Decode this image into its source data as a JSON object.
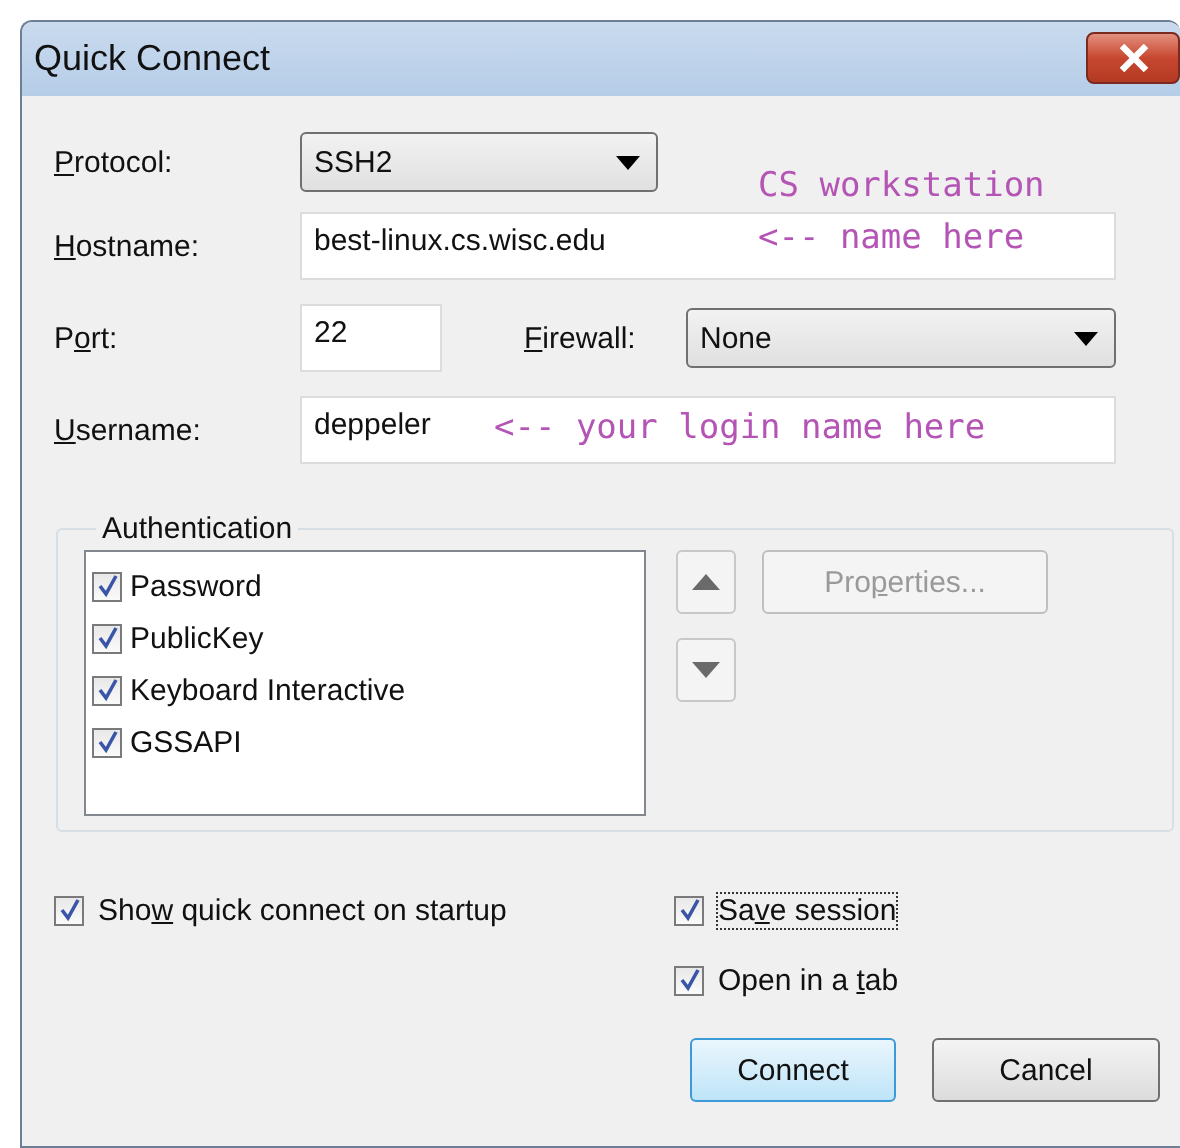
{
  "window": {
    "title": "Quick Connect"
  },
  "protocol": {
    "label": [
      {
        "t": "P",
        "u": true
      },
      {
        "t": "rotocol:",
        "u": false
      }
    ],
    "value": "SSH2"
  },
  "hostname": {
    "label": [
      {
        "t": "H",
        "u": true
      },
      {
        "t": "ostname:",
        "u": false
      }
    ],
    "value": "best-linux.cs.wisc.edu",
    "note_above": "CS workstation",
    "note": "<-- name here"
  },
  "port": {
    "label": [
      {
        "t": "P",
        "u": false
      },
      {
        "t": "o",
        "u": true
      },
      {
        "t": "rt:",
        "u": false
      }
    ],
    "value": "22"
  },
  "firewall": {
    "label": [
      {
        "t": "F",
        "u": true
      },
      {
        "t": "irewall:",
        "u": false
      }
    ],
    "value": "None"
  },
  "username": {
    "label": [
      {
        "t": "U",
        "u": true
      },
      {
        "t": "sername:",
        "u": false
      }
    ],
    "value": "deppeler",
    "note": "<-- your login name here"
  },
  "authentication": {
    "title": "Authentication",
    "methods": [
      {
        "label": "Password",
        "checked": true
      },
      {
        "label": "PublicKey",
        "checked": true
      },
      {
        "label": "Keyboard Interactive",
        "checked": true
      },
      {
        "label": "GSSAPI",
        "checked": true
      }
    ],
    "properties_button": {
      "label": [
        {
          "t": "Pro",
          "u": false
        },
        {
          "t": "p",
          "u": true
        },
        {
          "t": "erties...",
          "u": false
        }
      ],
      "disabled": true
    }
  },
  "options": [
    {
      "label": [
        {
          "t": "Sho",
          "u": false
        },
        {
          "t": "w",
          "u": true
        },
        {
          "t": " quick connect on startup",
          "u": false
        }
      ],
      "checked": true,
      "focused": false
    },
    {
      "label": [
        {
          "t": "Sa",
          "u": false
        },
        {
          "t": "v",
          "u": true
        },
        {
          "t": "e session",
          "u": false
        }
      ],
      "checked": true,
      "focused": true
    },
    {
      "label": [
        {
          "t": "Open in a ",
          "u": false
        },
        {
          "t": "t",
          "u": true
        },
        {
          "t": "ab",
          "u": false
        }
      ],
      "checked": true,
      "focused": false
    }
  ],
  "buttons": [
    {
      "label": "Connect",
      "default": true
    },
    {
      "label": "Cancel",
      "default": false
    }
  ]
}
